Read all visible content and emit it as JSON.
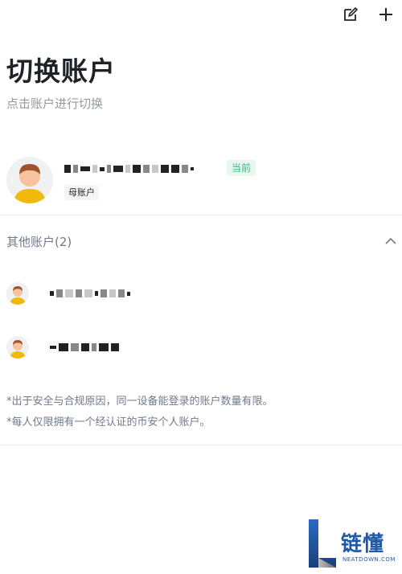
{
  "header": {
    "title": "切换账户",
    "subtitle": "点击账户进行切换"
  },
  "current_account": {
    "badge": "当前",
    "tag": "母账户"
  },
  "other_accounts": {
    "title": "其他账户(2)"
  },
  "notes": [
    "*出于安全与合规原因，同一设备能登录的账户数量有限。",
    "*每人仅限拥有一个经认证的币安个人账户。"
  ],
  "watermark": {
    "text": "链懂",
    "sub": "NEATDOWN.COM"
  },
  "colors": {
    "primary_text": "#1e2329",
    "secondary_text": "#707a8a",
    "current_badge_bg": "#e8f8ef",
    "current_badge_text": "#2ebd85",
    "avatar_face": "#f7c39f",
    "avatar_hair": "#a0522d",
    "avatar_shirt": "#f0b90b"
  }
}
